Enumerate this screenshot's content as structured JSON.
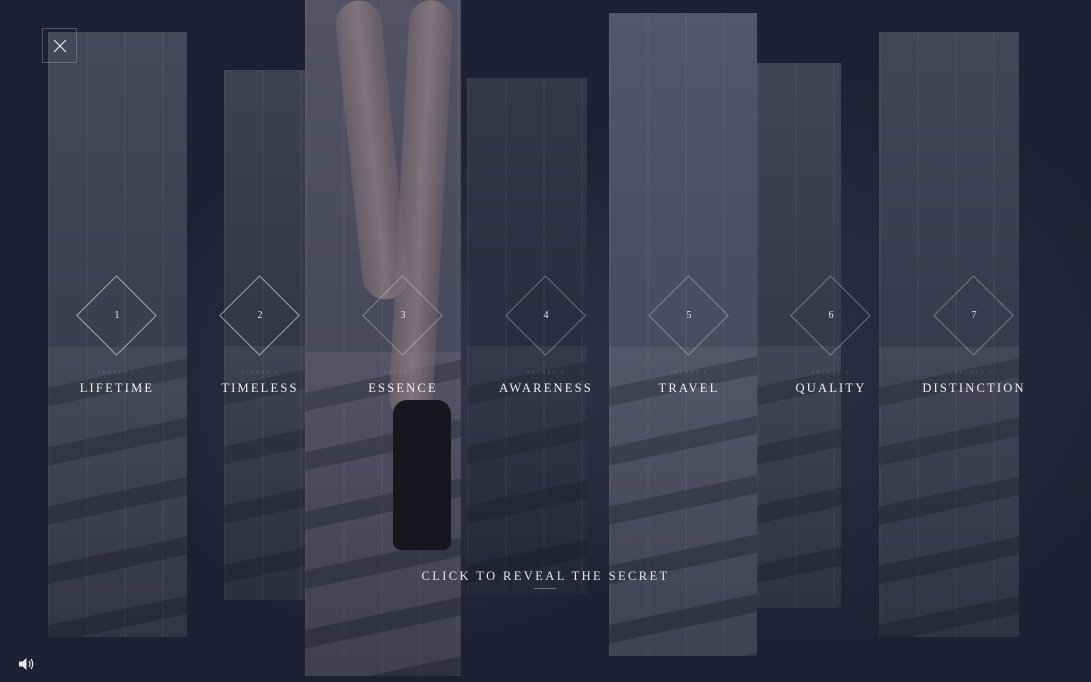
{
  "close_button": {
    "icon": "close-icon"
  },
  "sound_button": {
    "icon": "speaker-icon"
  },
  "secrets": [
    {
      "number": "1",
      "sublabel": "SECRET 1",
      "title": "LIFETIME"
    },
    {
      "number": "2",
      "sublabel": "SECRET 2",
      "title": "TIMELESS"
    },
    {
      "number": "3",
      "sublabel": "SECRET 3",
      "title": "ESSENCE"
    },
    {
      "number": "4",
      "sublabel": "SECRET 4",
      "title": "AWARENESS"
    },
    {
      "number": "5",
      "sublabel": "SECRET 5",
      "title": "TRAVEL"
    },
    {
      "number": "6",
      "sublabel": "SECRET 6",
      "title": "QUALITY"
    },
    {
      "number": "7",
      "sublabel": "SECRET 7",
      "title": "DISTINCTION"
    }
  ],
  "cta": {
    "label": "CLICK TO REVEAL THE SECRET"
  },
  "colors": {
    "background": "#1e2033",
    "text": "#f1eff5"
  }
}
